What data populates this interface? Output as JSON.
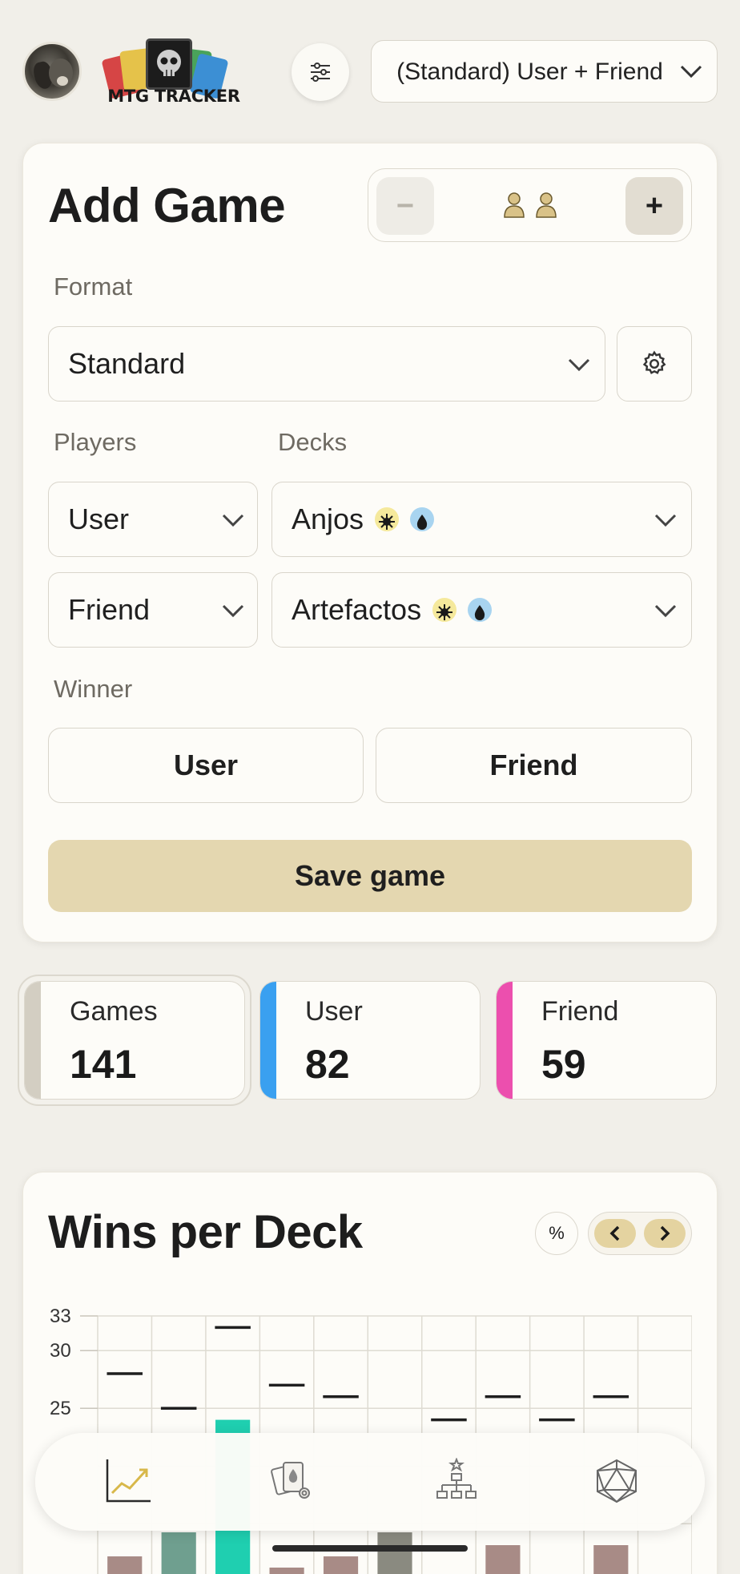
{
  "header": {
    "logo_text": "MTG TRACKER",
    "group_select": "(Standard) User + Friend"
  },
  "add_game": {
    "title": "Add Game",
    "player_count": 2,
    "stepper_minus": "−",
    "stepper_plus": "+",
    "format_label": "Format",
    "format_value": "Standard",
    "players_label": "Players",
    "decks_label": "Decks",
    "rows": [
      {
        "player": "User",
        "deck": "Anjos",
        "mana": [
          "white",
          "blue"
        ]
      },
      {
        "player": "Friend",
        "deck": "Artefactos",
        "mana": [
          "white",
          "blue"
        ]
      }
    ],
    "winner_label": "Winner",
    "winner_options": [
      "User",
      "Friend"
    ],
    "save_label": "Save game"
  },
  "stats": [
    {
      "label": "Games",
      "value": "141",
      "color": "#d3cec2"
    },
    {
      "label": "User",
      "value": "82",
      "color": "#3aa0f0"
    },
    {
      "label": "Friend",
      "value": "59",
      "color": "#ec4fae"
    }
  ],
  "wins_chart": {
    "title": "Wins per Deck",
    "pct_label": "%"
  },
  "chart_data": {
    "type": "bar",
    "title": "Wins per Deck",
    "y_ticks": [
      "33",
      "30",
      "25"
    ],
    "ylim": [
      0,
      33
    ],
    "grid": true,
    "markers": [
      28,
      25,
      32,
      27,
      26,
      null,
      24,
      26,
      24,
      26,
      null
    ],
    "visible_bar_tops": [
      null,
      null,
      24,
      null,
      null,
      null,
      null,
      null,
      null,
      null,
      null
    ]
  },
  "colors": {
    "background": "#f1efe9",
    "panel": "#fdfcf8",
    "accent": "#e4d7b0",
    "user": "#3aa0f0",
    "friend": "#ec4fae",
    "teal": "#1fcfb0",
    "muted_bar": "#a88b86"
  },
  "bottom_nav": {
    "items": [
      "stats-chart-icon",
      "decks-icon",
      "tournament-icon",
      "d20-icon"
    ]
  }
}
